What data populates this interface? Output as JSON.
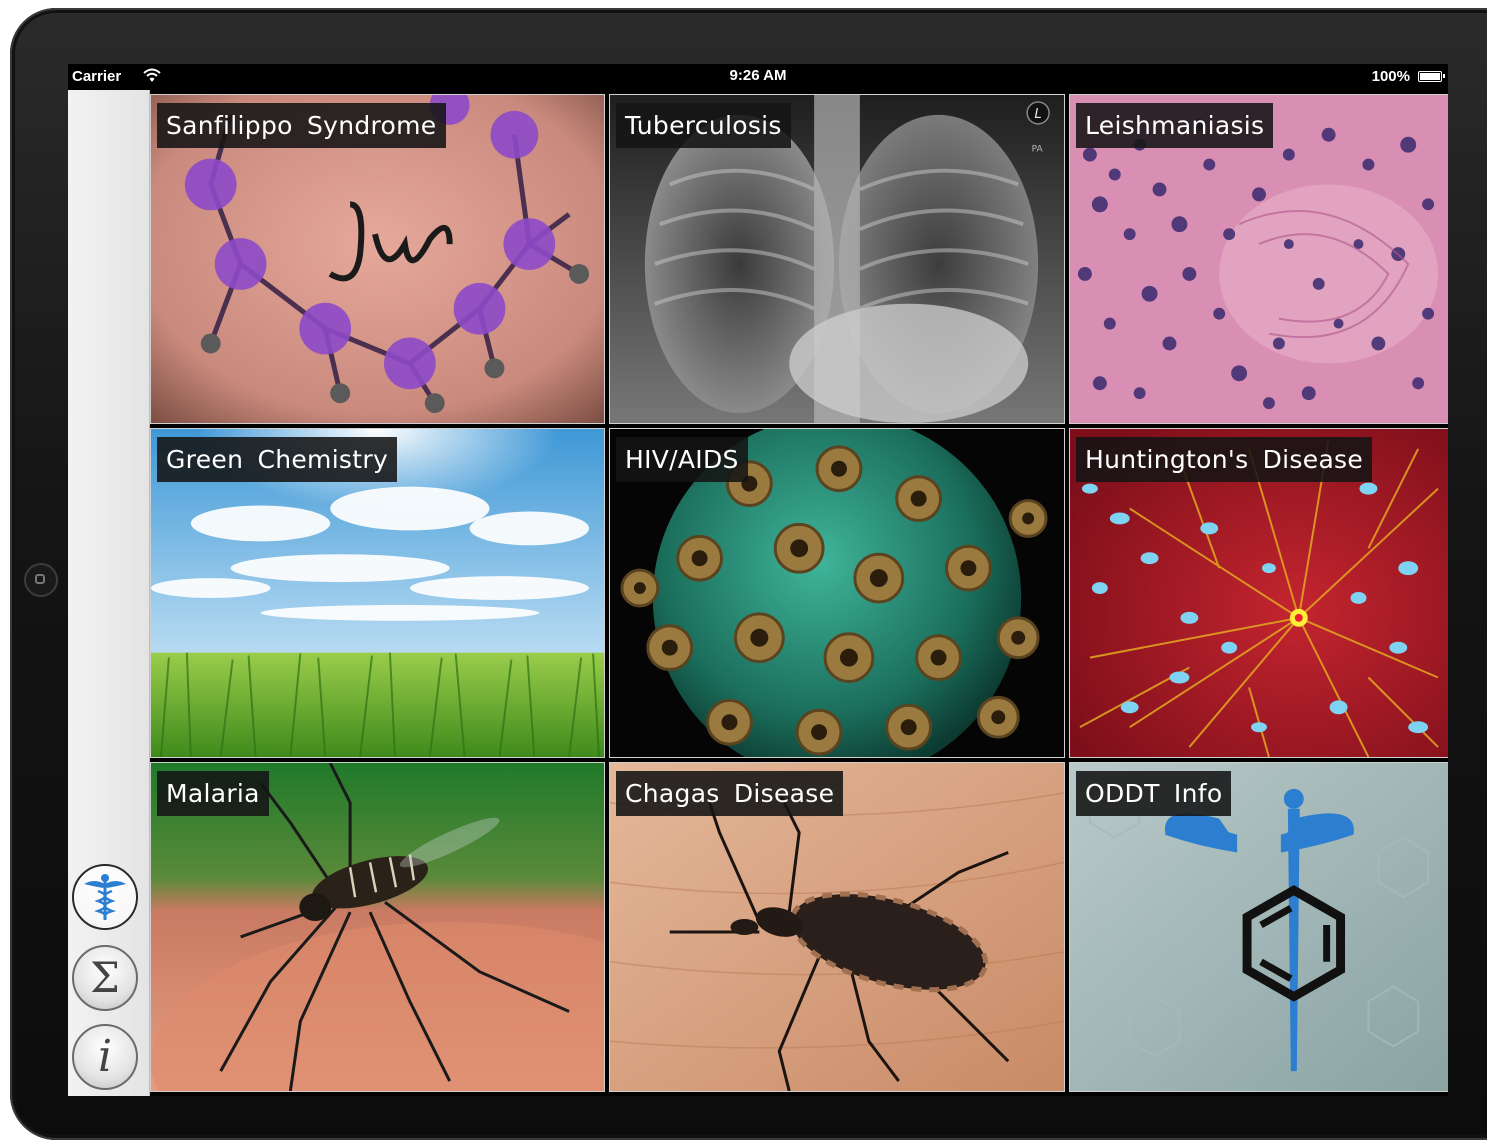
{
  "status_bar": {
    "carrier": "Carrier",
    "time": "9:26 AM",
    "battery": "100%"
  },
  "sidebar": {
    "buttons": [
      {
        "icon": "caduceus-icon",
        "active": true
      },
      {
        "icon": "sigma-icon",
        "glyph": "Σ",
        "active": false
      },
      {
        "icon": "info-icon",
        "glyph": "i",
        "active": false
      }
    ]
  },
  "tiles": [
    {
      "label": "Sanfilippo  Syndrome",
      "image": "tattoo-molecule-image"
    },
    {
      "label": "Tuberculosis",
      "image": "chest-xray-image",
      "marker": "L",
      "marker_sub": "PA"
    },
    {
      "label": "Leishmaniasis",
      "image": "tissue-histology-image"
    },
    {
      "label": "Green  Chemistry",
      "image": "sky-grass-image"
    },
    {
      "label": "HIV/AIDS",
      "image": "virus-particle-image"
    },
    {
      "label": "Huntington's  Disease",
      "image": "neuron-image"
    },
    {
      "label": "Malaria",
      "image": "mosquito-image"
    },
    {
      "label": "Chagas  Disease",
      "image": "kissing-bug-image"
    },
    {
      "label": "ODDT  Info",
      "image": "caduceus-benzene-image"
    }
  ],
  "colors": {
    "label_bg": "#141414",
    "accent_blue": "#2c7fd0"
  }
}
